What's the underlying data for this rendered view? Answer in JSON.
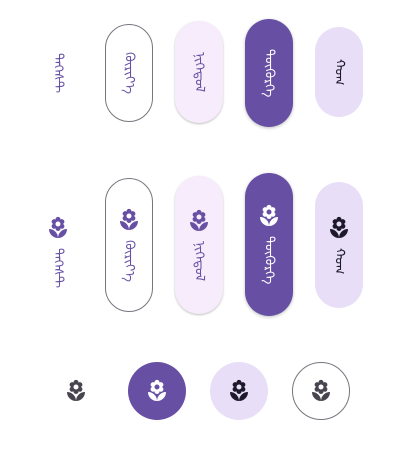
{
  "row1": {
    "text_label": "ᠲᠡᠬᠡᠰᠲ",
    "outlined_label": "ᠬᠦᠷᠢᠶ᠎ᠡ",
    "tonal_label": "ᠨᠢᠭᠡᠳᠦᠯ",
    "filled_label": "ᠳᠦᠭᠦᠷᠭᠡ",
    "secondary_label": "ᠬᠣᠭ"
  },
  "row2": {
    "text_label": "ᠲᠡᠬᠡᠰᠲ",
    "outlined_label": "ᠬᠦᠷᠢᠶ᠎ᠡ",
    "tonal_label": "ᠨᠢᠭᠡᠳᠦᠯ",
    "filled_label": "ᠳᠦᠭᠦᠷᠭᠡ",
    "secondary_label": "ᠬᠣᠭ"
  },
  "icons": {
    "button_icon": "flower-icon"
  },
  "colors": {
    "primary": "#6750a4",
    "tonal_bg": "#f6ecfb",
    "secondary_bg": "#e8def8",
    "outline": "#79747e",
    "on_surface": "#1d192b"
  }
}
